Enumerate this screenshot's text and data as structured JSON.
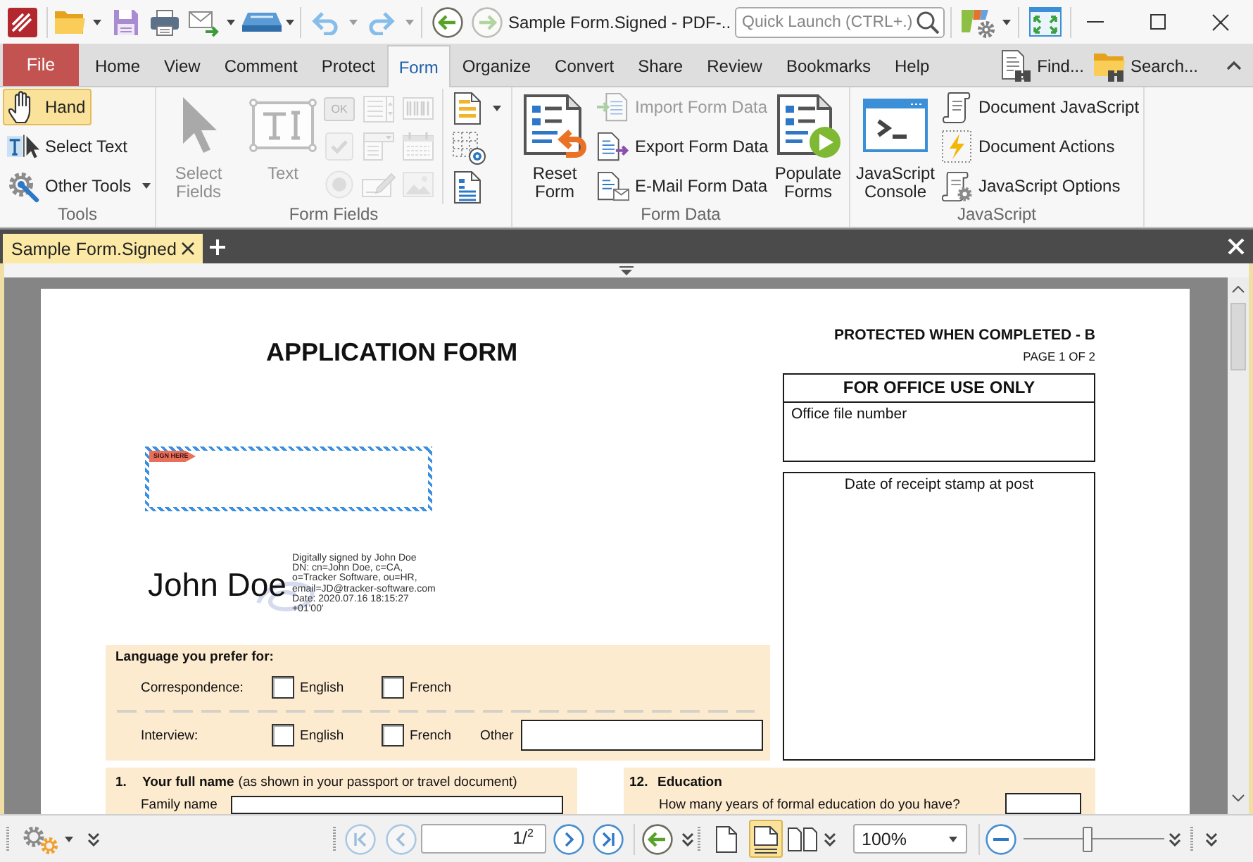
{
  "title_bar": {
    "title": "Sample Form.Signed - PDF-..",
    "nav": [
      {
        "disabled": false
      },
      {
        "disabled": true
      }
    ],
    "quick_launch": {
      "placeholder": "Quick Launch (CTRL+.)"
    }
  },
  "menu": {
    "tabs": [
      {
        "label": "File",
        "kind": "file",
        "selected": false
      },
      {
        "label": "Home",
        "kind": "tab",
        "selected": false
      },
      {
        "label": "View",
        "kind": "tab",
        "selected": false
      },
      {
        "label": "Comment",
        "kind": "tab",
        "selected": false
      },
      {
        "label": "Protect",
        "kind": "tab",
        "selected": false
      },
      {
        "label": "Form",
        "kind": "tab",
        "selected": true
      },
      {
        "label": "Organize",
        "kind": "tab",
        "selected": false
      },
      {
        "label": "Convert",
        "kind": "tab",
        "selected": false
      },
      {
        "label": "Share",
        "kind": "tab",
        "selected": false
      },
      {
        "label": "Review",
        "kind": "tab",
        "selected": false
      },
      {
        "label": "Bookmarks",
        "kind": "tab",
        "selected": false
      },
      {
        "label": "Help",
        "kind": "tab",
        "selected": false
      }
    ],
    "tools": [
      {
        "label": "Find..."
      },
      {
        "label": "Search..."
      }
    ]
  },
  "ribbon": {
    "groups": [
      {
        "label": "Tools",
        "blocks": [
          {
            "kind": "stack",
            "items": [
              {
                "label": "Hand",
                "selected": true
              },
              {
                "label": "Select Text",
                "selected": false
              },
              {
                "label": "Other Tools",
                "selected": false
              }
            ]
          }
        ]
      },
      {
        "label": "Form Fields",
        "blocks": [
          {
            "kind": "large",
            "label": "Select Fields",
            "disabled": true
          },
          {
            "kind": "large",
            "label": "Text",
            "disabled": true
          },
          {
            "kind": "grid",
            "items": [
              {
                "label": "OK",
                "disabled": true
              },
              {
                "disabled": true
              },
              {
                "disabled": true
              },
              {
                "disabled": true
              },
              {
                "disabled": true
              },
              {
                "disabled": true
              },
              {
                "disabled": true
              },
              {
                "disabled": true
              },
              {
                "disabled": true
              }
            ]
          },
          {
            "kind": "icons",
            "items": [
              {
                "disabled": false
              },
              {
                "disabled": false
              },
              {
                "disabled": false
              }
            ]
          }
        ]
      },
      {
        "label": "Form Data",
        "blocks": [
          {
            "kind": "large",
            "label": "Reset Form",
            "disabled": false
          },
          {
            "kind": "stack",
            "items": [
              {
                "label": "Import Form Data",
                "disabled": true
              },
              {
                "label": "Export Form Data",
                "disabled": false
              },
              {
                "label": "E-Mail Form Data",
                "disabled": false
              }
            ]
          },
          {
            "kind": "large",
            "label": "Populate Forms",
            "disabled": false
          }
        ]
      },
      {
        "label": "JavaScript",
        "blocks": [
          {
            "kind": "large",
            "label": "JavaScript Console"
          },
          {
            "kind": "stack",
            "items": [
              {
                "label": "Document JavaScript"
              },
              {
                "label": "Document Actions"
              },
              {
                "label": "JavaScript Options"
              }
            ]
          }
        ]
      }
    ]
  },
  "document_tabs": [
    {
      "label": "Sample Form.Signed",
      "selected": true
    }
  ],
  "page": {
    "title": "APPLICATION FORM",
    "protection_note": "PROTECTED WHEN COMPLETED - B",
    "page_label": "PAGE 1 OF 2",
    "signature_field": {
      "tag": "SIGN HERE"
    },
    "signature": {
      "name": "John Doe",
      "details": [
        "Digitally signed by John Doe",
        "DN: cn=John Doe, c=CA,",
        "o=Tracker Software, ou=HR,",
        "email=JD@tracker-software.com",
        "Date: 2020.07.16 18:15:27",
        "+01'00'"
      ]
    },
    "office_box": {
      "title": "FOR OFFICE USE ONLY",
      "field_label": "Office file number"
    },
    "stamp_box": {
      "label": "Date of receipt stamp at post"
    },
    "language": {
      "heading": "Language you prefer for:",
      "rows": [
        {
          "label": "Correspondence:",
          "options": [
            {
              "label": "English",
              "checked": false
            },
            {
              "label": "French",
              "checked": false
            }
          ]
        },
        {
          "label": "Interview:",
          "options": [
            {
              "label": "English",
              "checked": false
            },
            {
              "label": "French",
              "checked": false
            }
          ],
          "other": {
            "label": "Other"
          }
        }
      ]
    },
    "sections": [
      {
        "number": "1.",
        "title": "Your full name",
        "note": "(as shown in your passport or travel document)",
        "fields": [
          {
            "label": "Family name"
          }
        ]
      },
      {
        "number": "12.",
        "title": "Education",
        "fields": [
          {
            "label": "How many years of formal education do you have?"
          }
        ]
      }
    ]
  },
  "status_bar": {
    "page_nav": [
      {
        "disabled": true
      },
      {
        "disabled": true
      },
      {
        "disabled": false
      },
      {
        "disabled": false
      }
    ],
    "page_field": "1/$^{2}$",
    "view_modes": [
      {
        "selected": false
      },
      {
        "selected": true
      },
      {
        "selected": false
      }
    ],
    "zoom": {
      "value": "100%"
    },
    "zoom_slider": {
      "level": 0.45
    }
  }
}
